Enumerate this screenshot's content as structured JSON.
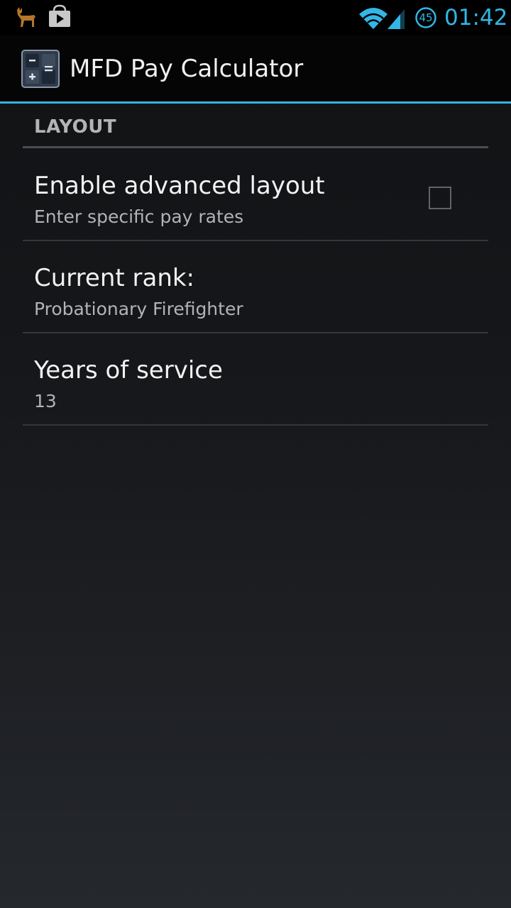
{
  "status_bar": {
    "notification_icons": [
      "deer-icon",
      "play-store-icon"
    ],
    "wifi": "wifi-icon",
    "signal": "signal-icon",
    "battery_level": "45",
    "time": "01:42",
    "accent_color": "#33b5e5"
  },
  "action_bar": {
    "app_icon": "calculator-icon",
    "title": "MFD Pay Calculator"
  },
  "preferences": {
    "category": "LAYOUT",
    "items": [
      {
        "title": "Enable advanced layout",
        "summary": "Enter specific pay rates",
        "checkbox": false
      },
      {
        "title": "Current rank:",
        "summary": "Probationary Firefighter"
      },
      {
        "title": "Years of service",
        "summary": "13"
      }
    ]
  }
}
